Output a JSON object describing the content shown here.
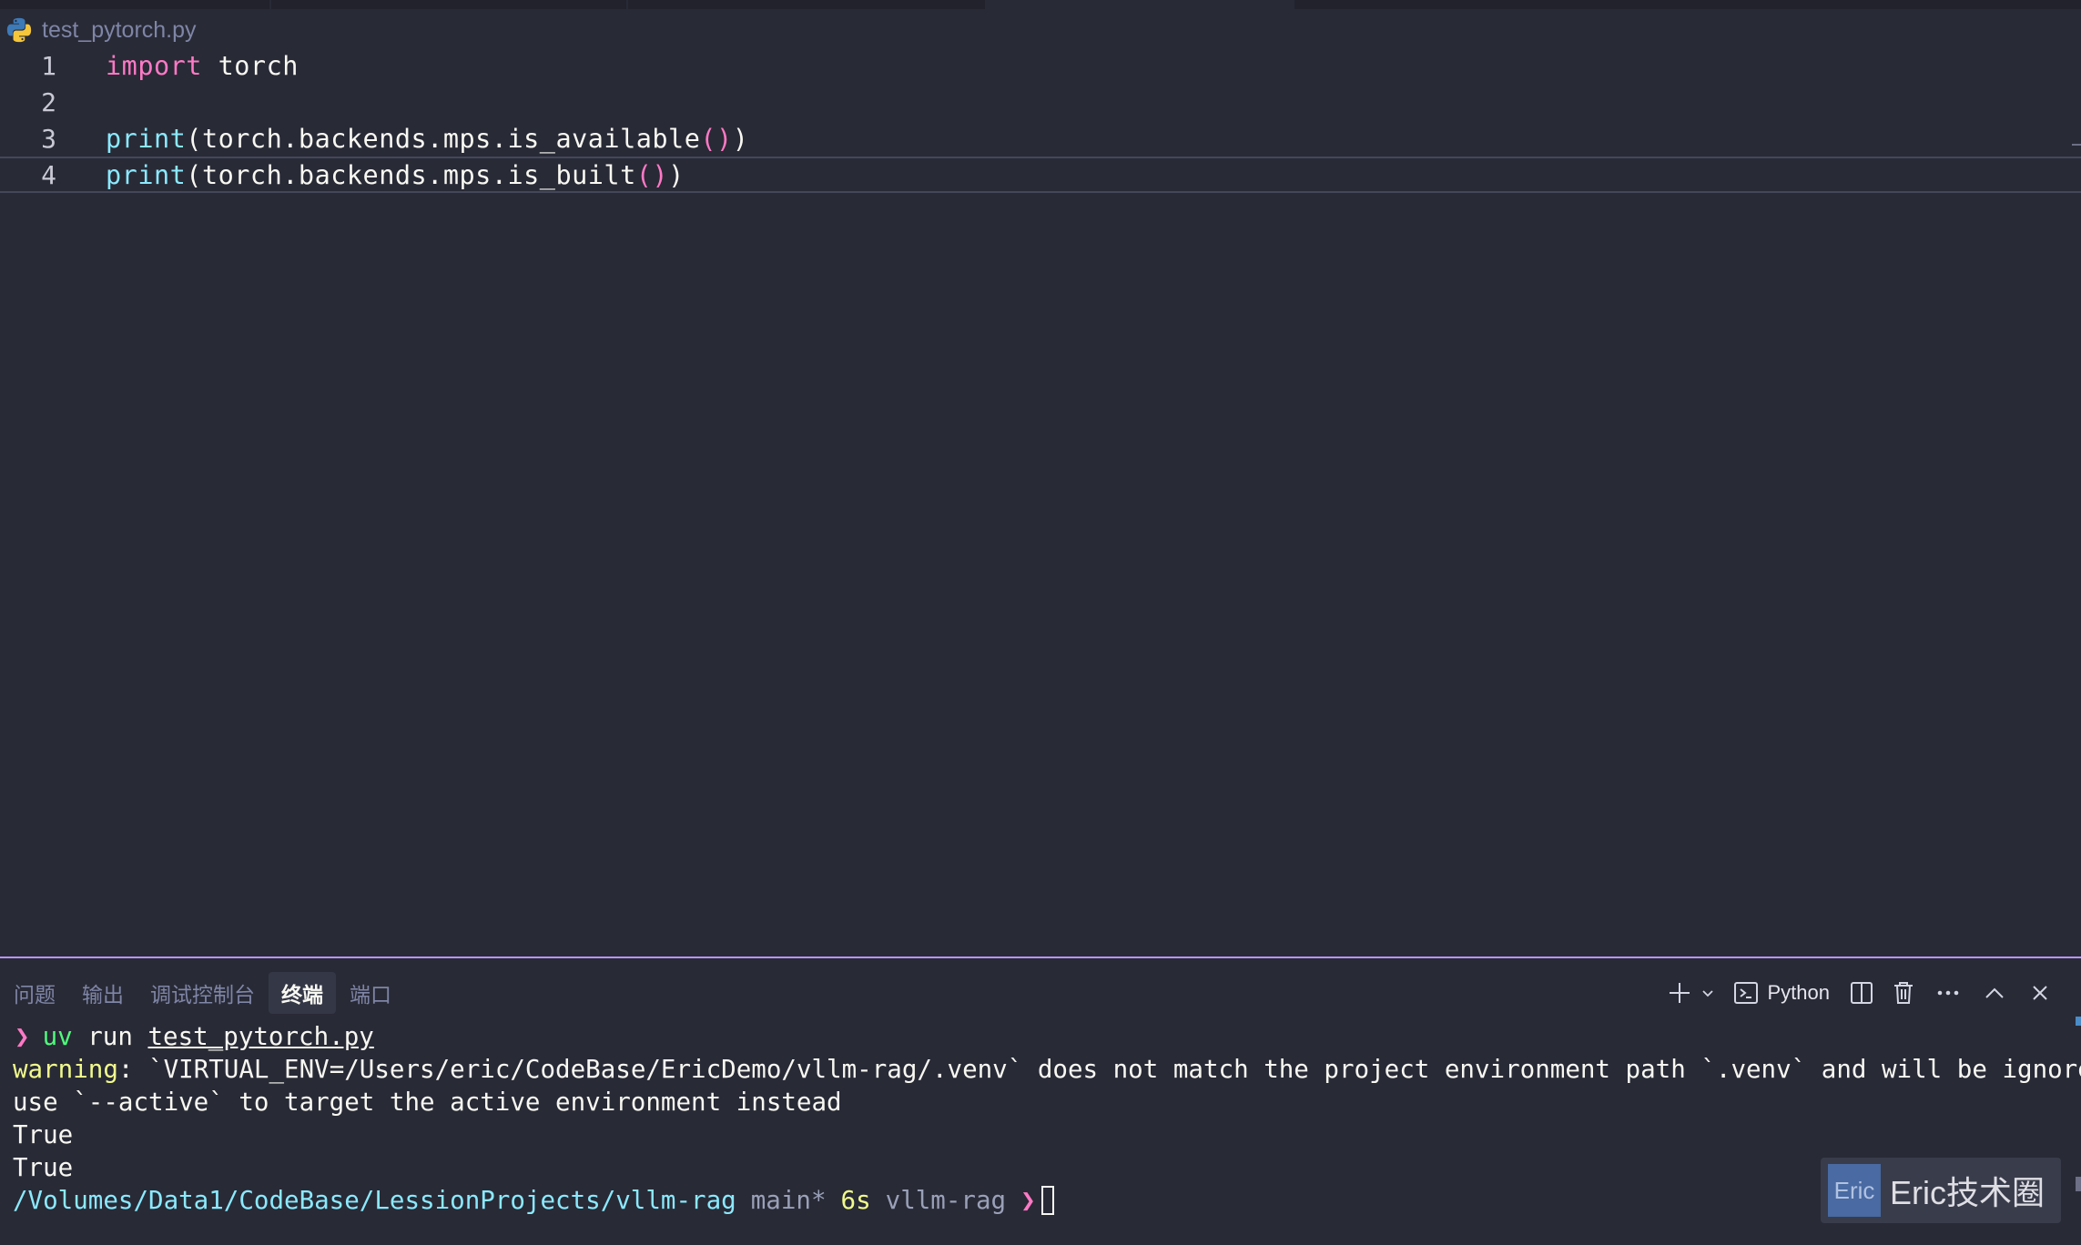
{
  "breadcrumb": {
    "file": "test_pytorch.py"
  },
  "editor": {
    "lines": [
      {
        "num": "1",
        "parts": [
          [
            "kw",
            "import"
          ],
          [
            "plain",
            " torch"
          ]
        ]
      },
      {
        "num": "2",
        "parts": []
      },
      {
        "num": "3",
        "parts": [
          [
            "fn",
            "print"
          ],
          [
            "plain",
            "(torch.backends.mps.is_available"
          ],
          [
            "paren-pink",
            "()"
          ],
          [
            "plain",
            ")"
          ]
        ]
      },
      {
        "num": "4",
        "parts": [
          [
            "fn",
            "print"
          ],
          [
            "plain",
            "(torch.backends.mps.is_built"
          ],
          [
            "paren-pink",
            "()"
          ],
          [
            "plain",
            ")"
          ]
        ]
      }
    ]
  },
  "panel": {
    "tabs": [
      "问题",
      "输出",
      "调试控制台",
      "终端",
      "端口"
    ],
    "active_tab": "终端",
    "shell_label": "Python"
  },
  "terminal": {
    "prompt_arrow": "❯",
    "cmd_bin": "uv",
    "cmd_rest": " run ",
    "cmd_file": "test_pytorch.py",
    "warning_label": "warning",
    "warning_text": ": `VIRTUAL_ENV=/Users/eric/CodeBase/EricDemo/vllm-rag/.venv` does not match the project environment path `.venv` and will be ignored;",
    "warning_text2": "use `--active` to target the active environment instead",
    "output1": "True",
    "output2": "True",
    "cwd": "/Volumes/Data1/CodeBase/LessionProjects/vllm-rag",
    "branch": "main*",
    "duration": "6s",
    "venv": "vllm-rag"
  },
  "watermark": {
    "badge": "Eric",
    "text": "Eric技术圈"
  },
  "colors": {
    "accent": "#bd93f9",
    "background": "#282a36",
    "keyword": "#ff79c6",
    "function": "#8be9fd"
  }
}
